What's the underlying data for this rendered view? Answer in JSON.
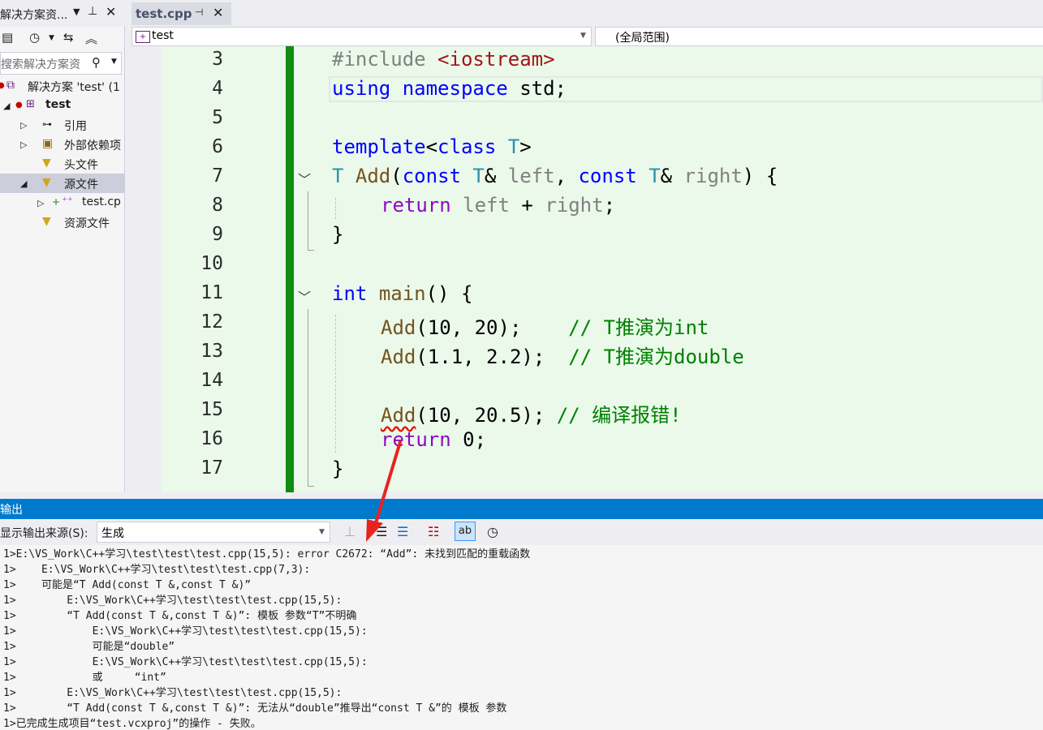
{
  "solution_explorer": {
    "title": "解决方案资...",
    "search_placeholder": "搜索解决方案资",
    "items": [
      {
        "label": "解决方案 'test' (1"
      },
      {
        "label": "test"
      },
      {
        "label": "引用"
      },
      {
        "label": "外部依赖项"
      },
      {
        "label": "头文件"
      },
      {
        "label": "源文件"
      },
      {
        "label": "test.cp"
      },
      {
        "label": "资源文件"
      }
    ]
  },
  "editor": {
    "tab_label": "test.cpp",
    "nav_scope_left": "test",
    "nav_scope_right": "(全局范围)",
    "line_numbers": [
      "3",
      "4",
      "5",
      "6",
      "7",
      "8",
      "9",
      "10",
      "11",
      "12",
      "13",
      "14",
      "15",
      "16",
      "17"
    ],
    "code": {
      "l3_pp": "#include ",
      "l3_hdr": "<iostream>",
      "l4_kw1": "using",
      "l4_kw2": "namespace",
      "l4_rest": " std;",
      "l6_kw1": "template",
      "l6_p1": "<",
      "l6_kw2": "class",
      "l6_ty": "T",
      "l6_p2": ">",
      "l7_ty1": "T",
      "l7_fn": "Add",
      "l7_p1": "(",
      "l7_kw1": "const",
      "l7_ty2": "T",
      "l7_p2": "& ",
      "l7_pm1": "left",
      "l7_p3": ", ",
      "l7_kw2": "const",
      "l7_ty3": "T",
      "l7_p4": "& ",
      "l7_pm2": "right",
      "l7_p5": ") {",
      "l8_kw": "return",
      "l8_pm1": "left",
      "l8_op": " + ",
      "l8_pm2": "right",
      "l8_end": ";",
      "l9": "}",
      "l11_kw": "int",
      "l11_fn": "main",
      "l11_rest": "() {",
      "l12_fn": "Add",
      "l12_args": "(10, 20);    ",
      "l12_ct": "// T推演为int",
      "l13_fn": "Add",
      "l13_args": "(1.1, 2.2);  ",
      "l13_ct": "// T推演为double",
      "l15_fn": "Add",
      "l15_args": "(10, 20.5); ",
      "l15_ct": "// 编译报错!",
      "l16_kw": "return",
      "l16_rest": " 0;",
      "l17": "}"
    }
  },
  "output": {
    "title": "输出",
    "source_label": "显示输出来源(S):",
    "source_value": "生成",
    "lines": [
      "1>E:\\VS_Work\\C++学习\\test\\test\\test.cpp(15,5): error C2672: “Add”: 未找到匹配的重载函数",
      "1>    E:\\VS_Work\\C++学习\\test\\test\\test.cpp(7,3):",
      "1>    可能是“T Add(const T &,const T &)”",
      "1>        E:\\VS_Work\\C++学习\\test\\test\\test.cpp(15,5):",
      "1>        “T Add(const T &,const T &)”: 模板 参数“T”不明确",
      "1>            E:\\VS_Work\\C++学习\\test\\test\\test.cpp(15,5):",
      "1>            可能是“double”",
      "1>            E:\\VS_Work\\C++学习\\test\\test\\test.cpp(15,5):",
      "1>            或     “int”",
      "1>        E:\\VS_Work\\C++学习\\test\\test\\test.cpp(15,5):",
      "1>        “T Add(const T &,const T &)”: 无法从“double”推导出“const T &”的 模板 参数",
      "1>已完成生成项目“test.vcxproj”的操作 - 失败。"
    ]
  },
  "colors": {
    "accent": "#007acc",
    "change_bar": "#108c10",
    "annotation_arrow": "#e8231e"
  }
}
